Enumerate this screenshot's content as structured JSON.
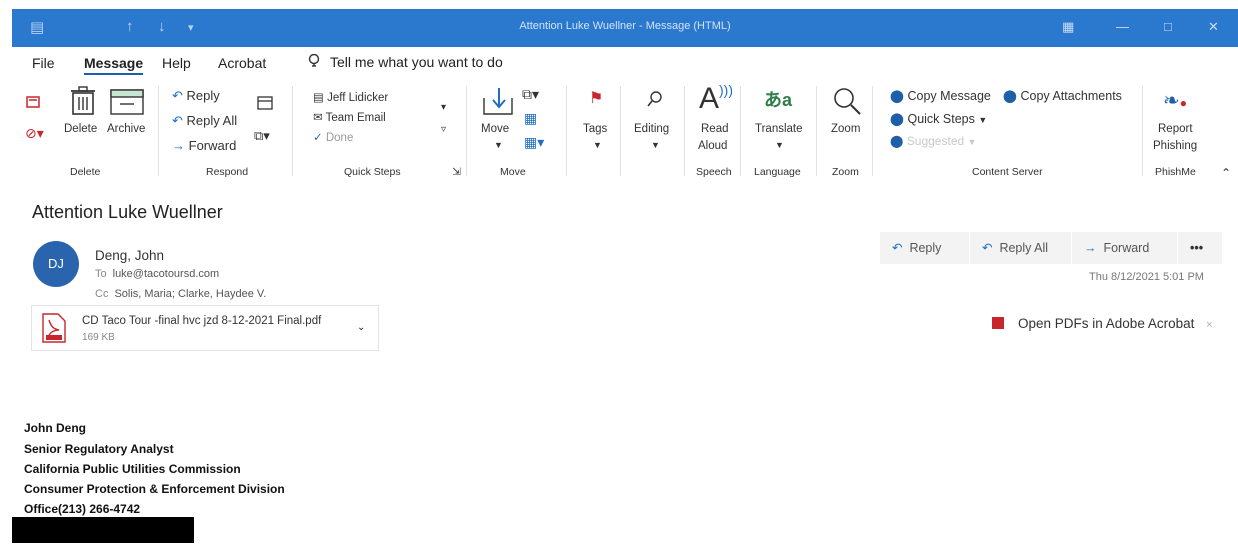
{
  "window": {
    "title": "Attention Luke Wuellner  -  Message (HTML)"
  },
  "menu": {
    "tabs": [
      "File",
      "Message",
      "Help",
      "Acrobat"
    ],
    "active_tab": "Message",
    "tell_me": "Tell me what you want to do"
  },
  "ribbon": {
    "delete_group": {
      "delete": "Delete",
      "archive": "Archive",
      "label": "Delete"
    },
    "respond_group": {
      "reply": "Reply",
      "reply_all": "Reply All",
      "forward": "Forward",
      "label": "Respond"
    },
    "quick_steps_group": {
      "items": [
        "Jeff Lidicker",
        "Team Email",
        "Done"
      ],
      "label": "Quick Steps"
    },
    "move_group": {
      "move": "Move",
      "label": "Move"
    },
    "tags_group": {
      "tags": "Tags"
    },
    "editing_group": {
      "editing": "Editing"
    },
    "speech_group": {
      "read_aloud_line1": "Read",
      "read_aloud_line2": "Aloud",
      "label": "Speech"
    },
    "language_group": {
      "translate": "Translate",
      "label": "Language"
    },
    "zoom_group": {
      "zoom": "Zoom",
      "label": "Zoom"
    },
    "content_server_group": {
      "copy_message": "Copy Message",
      "copy_attachments": "Copy Attachments",
      "quick_steps": "Quick Steps",
      "suggested": "Suggested",
      "label": "Content Server"
    },
    "phishme_group": {
      "report_line1": "Report",
      "report_line2": "Phishing",
      "label": "PhishMe"
    }
  },
  "message": {
    "subject": "Attention Luke Wuellner",
    "avatar_initials": "DJ",
    "sender": "Deng, John",
    "to_label": "To",
    "to": "luke@tacotoursd.com",
    "cc_label": "Cc",
    "cc": "Solis, Maria; Clarke, Haydee V.",
    "datetime": "Thu 8/12/2021 5:01 PM",
    "actions": {
      "reply": "Reply",
      "reply_all": "Reply All",
      "forward": "Forward",
      "more": "•••"
    },
    "attachment": {
      "name": "CD Taco Tour -final hvc jzd 8-12-2021 Final.pdf",
      "size": "169 KB"
    },
    "pdf_banner": "Open PDFs in Adobe Acrobat"
  },
  "signature": {
    "name": "John Deng",
    "title": "Senior Regulatory Analyst",
    "org": "California Public Utilities Commission",
    "division": "Consumer Protection & Enforcement Division",
    "phone": "Office(213) 266-4742"
  },
  "colors": {
    "title_bar": "#2b79cf",
    "avatar": "#2a64ad",
    "accent": "#1f6fc5",
    "pdf_red": "#c8262d"
  }
}
